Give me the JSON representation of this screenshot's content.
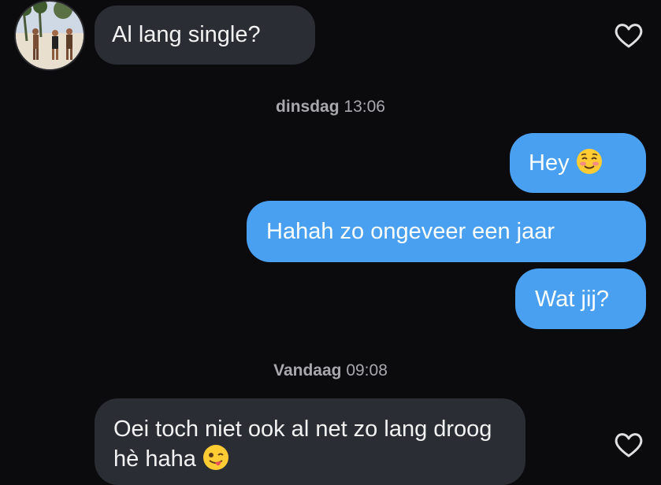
{
  "messages": [
    {
      "direction": "incoming",
      "text": "Al lang single?"
    },
    {
      "direction": "outgoing",
      "text": "Hey",
      "emoji": "smiling-face-with-blush-icon"
    },
    {
      "direction": "outgoing",
      "text": "Hahah zo ongeveer een jaar"
    },
    {
      "direction": "outgoing",
      "text": "Wat jij?"
    },
    {
      "direction": "incoming",
      "text": "Oei toch niet ook al net zo lang droog hè haha",
      "emoji": "winking-face-with-tongue-icon"
    }
  ],
  "separators": [
    {
      "day": "dinsdag",
      "time": "13:06"
    },
    {
      "day": "Vandaag",
      "time": "09:08"
    }
  ],
  "colors": {
    "background": "#0b0b0d",
    "incoming_bubble": "#2b2d35",
    "outgoing_bubble": "#4aa0f0",
    "timestamp": "#a9a9ad"
  },
  "icons": {
    "avatar": "avatar",
    "like": "heart-outline-icon"
  }
}
